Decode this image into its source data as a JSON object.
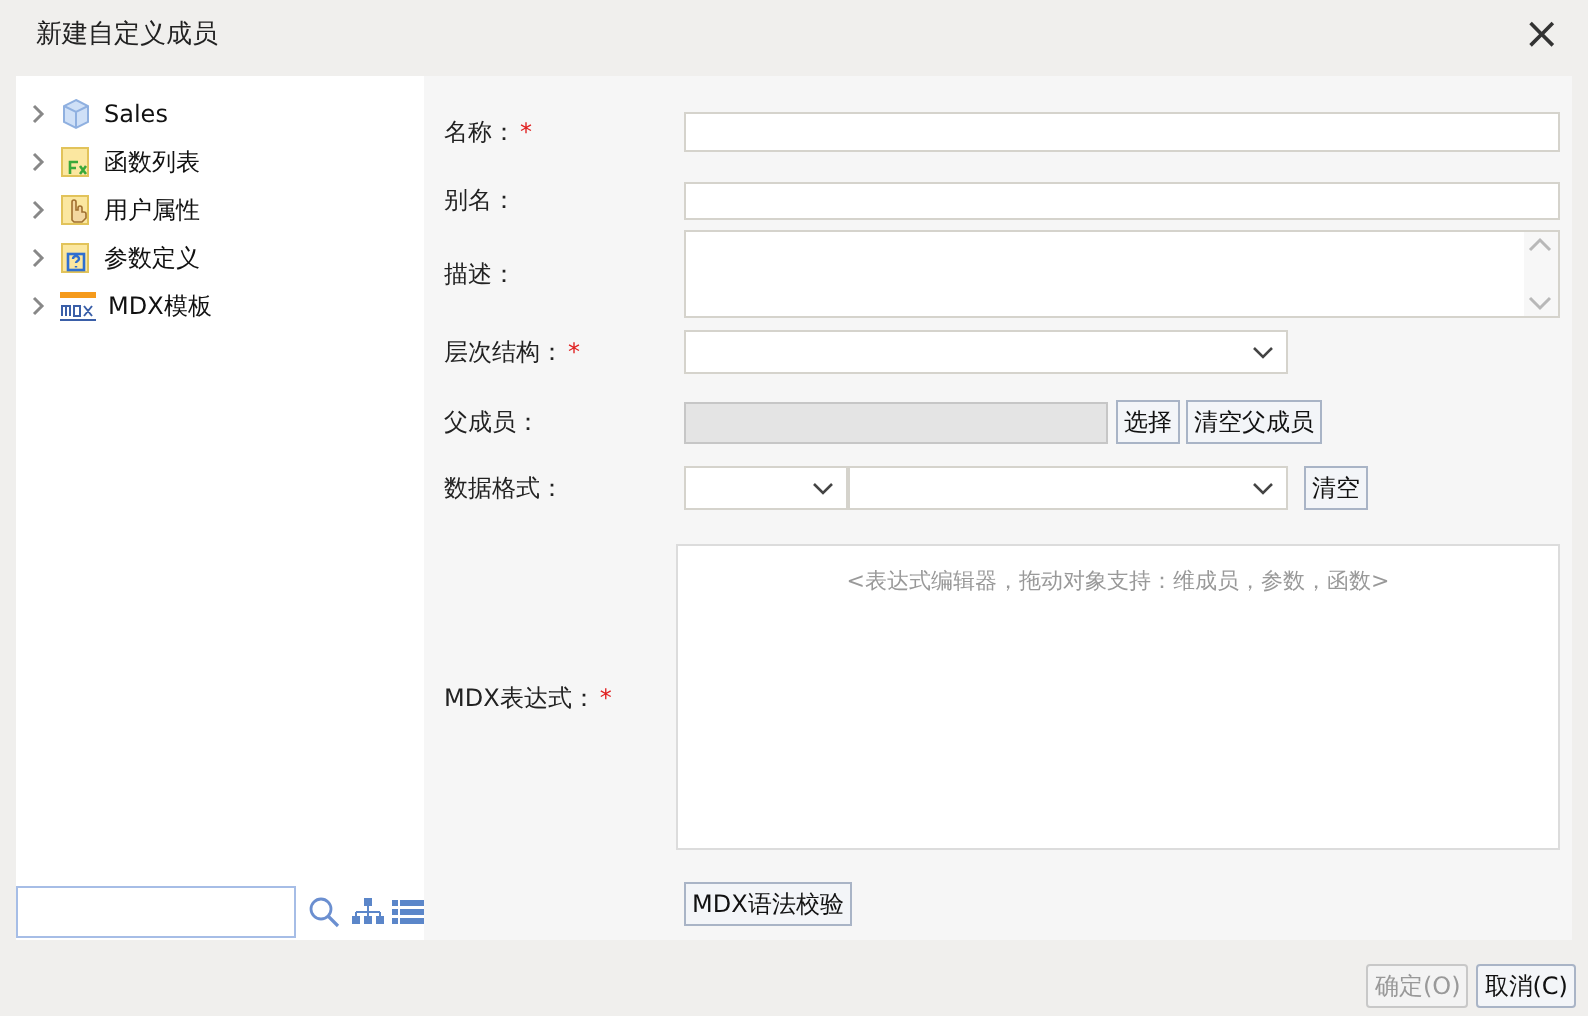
{
  "window": {
    "title": "新建自定义成员",
    "close": "×"
  },
  "tree": {
    "items": [
      {
        "label": "Sales",
        "kind": "cube",
        "expanded": false
      },
      {
        "label": "函数列表",
        "kind": "function",
        "expanded": false
      },
      {
        "label": "用户属性",
        "kind": "hand",
        "expanded": false
      },
      {
        "label": "参数定义",
        "kind": "param",
        "expanded": false
      },
      {
        "label": "MDX模板",
        "kind": "mdx",
        "expanded": false
      }
    ]
  },
  "form": {
    "name_label": "名称：",
    "alias_label": "别名：",
    "description_label": "描述：",
    "hierarchy_label": "层次结构：",
    "parent_label": "父成员：",
    "select_button": "选择",
    "clear_parent_button": "清空父成员",
    "format_label": "数据格式：",
    "clear_button": "清空",
    "mdx_label": "MDX表达式：",
    "required_mark": "*",
    "editor_placeholder": "<表达式编辑器，拖动对象支持：维成员，参数，函数>",
    "verify_button": "MDX语法校验"
  },
  "footer": {
    "buttons": [
      {
        "label": "确定(O)",
        "disabled": true
      },
      {
        "label": "取消(C)",
        "disabled": false
      }
    ]
  }
}
